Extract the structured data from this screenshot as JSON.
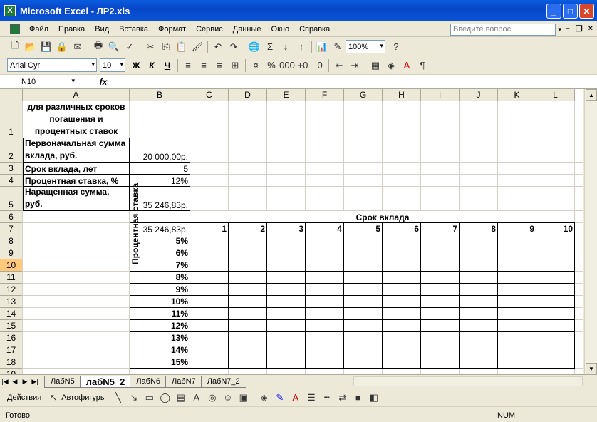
{
  "window": {
    "title": "Microsoft Excel - ЛР2.xls",
    "app_icon": "excel-icon"
  },
  "menu": [
    "Файл",
    "Правка",
    "Вид",
    "Вставка",
    "Формат",
    "Сервис",
    "Данные",
    "Окно",
    "Справка"
  ],
  "ask_question": {
    "placeholder": "Введите вопрос"
  },
  "toolbar": {
    "zoom": "100%",
    "font_name": "Arial Cyr",
    "font_size": "10",
    "bold": "Ж",
    "italic": "К",
    "underline": "Ч"
  },
  "formula_bar": {
    "name_box": "N10",
    "fx": "fx",
    "formula": ""
  },
  "columns": [
    "A",
    "B",
    "C",
    "D",
    "E",
    "F",
    "G",
    "H",
    "I",
    "J",
    "K",
    "L"
  ],
  "rows": [
    "1",
    "2",
    "3",
    "4",
    "5",
    "6",
    "7",
    "8",
    "9",
    "10",
    "11",
    "12",
    "13",
    "14",
    "15",
    "16",
    "17",
    "18",
    "19"
  ],
  "cells": {
    "A1": "Расчет суммы вклада для различных сроков погашения и процентных ставок",
    "A2": "Первоначальная сумма вклада, руб.",
    "B2": "20 000,00р.",
    "A3": "Срок вклада, лет",
    "B3": "5",
    "A4": "Процентная ставка, %",
    "B4": "12%",
    "A5": "Наращенная сумма, руб.",
    "B5": "35 246,83р.",
    "term_header": "Срок вклада",
    "B7": "35 246,83р.",
    "terms": [
      "1",
      "2",
      "3",
      "4",
      "5",
      "6",
      "7",
      "8",
      "9",
      "10"
    ],
    "rates": [
      "5%",
      "6%",
      "7%",
      "8%",
      "9%",
      "10%",
      "11%",
      "12%",
      "13%",
      "14%",
      "15%"
    ],
    "rate_label": "Процентная ставка"
  },
  "sheets": [
    "ЛабN5",
    "лабN5_2",
    "ЛабN6",
    "ЛабN7",
    "ЛабN7_2"
  ],
  "active_sheet": "лабN5_2",
  "drawing": {
    "actions": "Действия",
    "autoshapes": "Автофигуры"
  },
  "status": {
    "text": "Готово",
    "num": "NUM"
  }
}
